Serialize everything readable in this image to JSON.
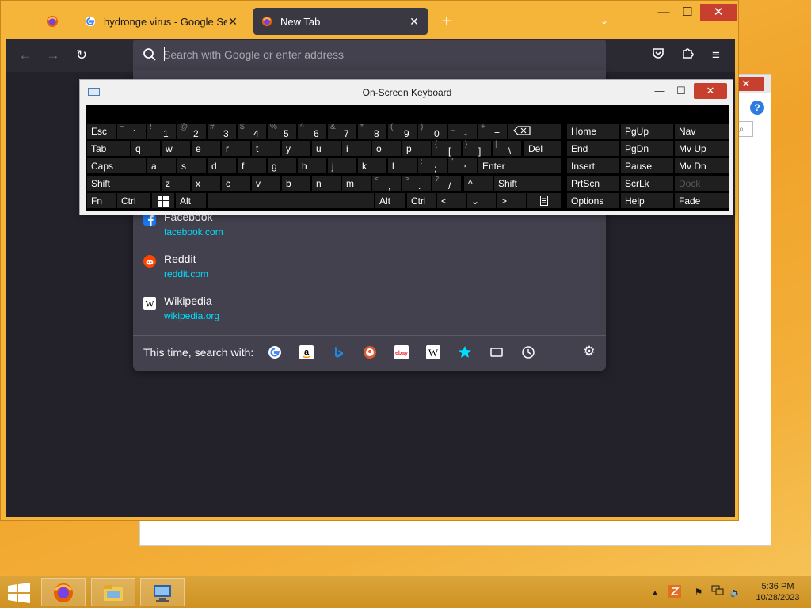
{
  "browser": {
    "tabs": [
      {
        "label": "hydronge virus - Google Search",
        "active": false
      },
      {
        "label": "New Tab",
        "active": true
      }
    ],
    "new_tab_glyph": "+",
    "window_controls": {
      "minimize": "—",
      "maximize": "☐",
      "close": "✕"
    }
  },
  "urlbar": {
    "placeholder": "Search with Google or enter address"
  },
  "suggestions": [
    {
      "name": "Facebook",
      "url": "facebook.com",
      "icon": "facebook-icon"
    },
    {
      "name": "Reddit",
      "url": "reddit.com",
      "icon": "reddit-icon"
    },
    {
      "name": "Wikipedia",
      "url": "wikipedia.org",
      "icon": "wikipedia-icon"
    }
  ],
  "oneoff": {
    "label": "This time, search with:",
    "engines": [
      "google-icon",
      "amazon-icon",
      "bing-icon",
      "duckduckgo-icon",
      "ebay-icon",
      "wikipedia-icon",
      "bookmarks-icon",
      "tabs-icon",
      "history-icon"
    ]
  },
  "osk": {
    "title": "On-Screen Keyboard",
    "keys": {
      "esc": "Esc",
      "tab": "Tab",
      "caps": "Caps",
      "shift_l": "Shift",
      "fn": "Fn",
      "ctrl_l": "Ctrl",
      "alt_l": "Alt",
      "alt_r": "Alt",
      "ctrl_r": "Ctrl",
      "del": "Del",
      "enter": "Enter",
      "shift_r": "Shift",
      "home": "Home",
      "pgup": "PgUp",
      "nav": "Nav",
      "end": "End",
      "pgdn": "PgDn",
      "mvup": "Mv Up",
      "insert": "Insert",
      "pause": "Pause",
      "mvdn": "Mv Dn",
      "prtscn": "PrtScn",
      "scrlk": "ScrLk",
      "dock": "Dock",
      "options": "Options",
      "help": "Help",
      "fade": "Fade",
      "left": "<",
      "down": "⌄",
      "right": ">",
      "up": "^"
    },
    "row1": [
      {
        "s": "~",
        "b": "`"
      },
      {
        "s": "!",
        "b": "1"
      },
      {
        "s": "@",
        "b": "2"
      },
      {
        "s": "#",
        "b": "3"
      },
      {
        "s": "$",
        "b": "4"
      },
      {
        "s": "%",
        "b": "5"
      },
      {
        "s": "^",
        "b": "6"
      },
      {
        "s": "&",
        "b": "7"
      },
      {
        "s": "*",
        "b": "8"
      },
      {
        "s": "(",
        "b": "9"
      },
      {
        "s": ")",
        "b": "0"
      },
      {
        "s": "_",
        "b": "-"
      },
      {
        "s": "+",
        "b": "="
      }
    ],
    "row2": [
      "q",
      "w",
      "e",
      "r",
      "t",
      "y",
      "u",
      "i",
      "o",
      "p"
    ],
    "row2_sym": [
      {
        "s": "{",
        "b": "["
      },
      {
        "s": "}",
        "b": "]"
      },
      {
        "s": "|",
        "b": "\\"
      }
    ],
    "row3": [
      "a",
      "s",
      "d",
      "f",
      "g",
      "h",
      "j",
      "k",
      "l"
    ],
    "row3_sym": [
      {
        "s": ":",
        "b": ";"
      },
      {
        "s": "\"",
        "b": "'"
      }
    ],
    "row4": [
      "z",
      "x",
      "c",
      "v",
      "b",
      "n",
      "m"
    ],
    "row4_sym": [
      {
        "s": "<",
        "b": ","
      },
      {
        "s": ">",
        "b": "."
      },
      {
        "s": "?",
        "b": "/"
      }
    ]
  },
  "taskbar": {
    "apps": [
      "firefox-icon",
      "file-explorer-icon",
      "remote-desktop-icon"
    ],
    "time": "5:36 PM",
    "date": "10/28/2023"
  },
  "colors": {
    "accent_cyan": "#00ddff",
    "toolbar": "#2b2a33",
    "panel": "#42414d",
    "close_red": "#c7402f"
  }
}
